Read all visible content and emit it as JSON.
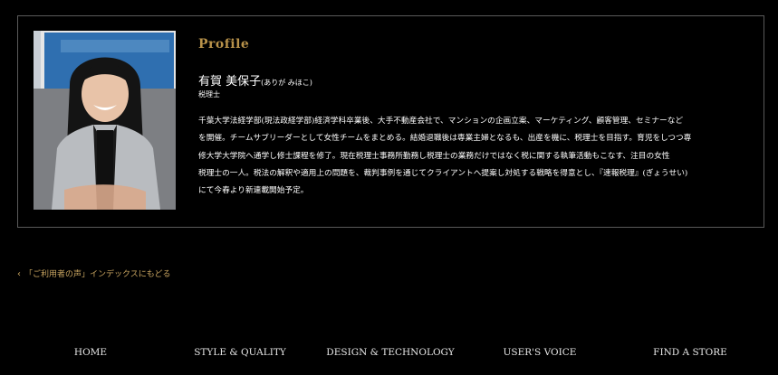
{
  "profile": {
    "heading": "Profile",
    "name": "有賀 美保子",
    "reading": "(ありが みほこ)",
    "role": "税理士",
    "bio_lines": [
      "千葉大学法経学部(現法政経学部)経済学科卒業後、大手不動産会社で、マンションの企画立案、マーケティング、顧客管理、セミナーなど",
      "を開催。チームサブリーダーとして女性チームをまとめる。結婚退職後は専業主婦となるも、出産を機に、税理士を目指す。育児をしつつ専",
      "修大学大学院へ通学し修士課程を修了。現在税理士事務所勤務し税理士の業務だけではなく税に関する執筆活動もこなす、注目の女性",
      "税理士の一人。税法の解釈や適用上の問題を、裁判事例を通じてクライアントへ提案し対処する戦略を得意とし、『速報税理』(ぎょうせい)",
      "にて今春より新連載開始予定。"
    ]
  },
  "back_link": {
    "label": "「ご利用者の声」インデックスにもどる"
  },
  "footer_nav": {
    "items": [
      "HOME",
      "STYLE & QUALITY",
      "DESIGN & TECHNOLOGY",
      "USER'S VOICE",
      "FIND A STORE"
    ]
  },
  "colors": {
    "accent_gold": "#b8924a",
    "link_gold": "#c9a560",
    "background": "#000000",
    "border": "#5a5a5a"
  }
}
